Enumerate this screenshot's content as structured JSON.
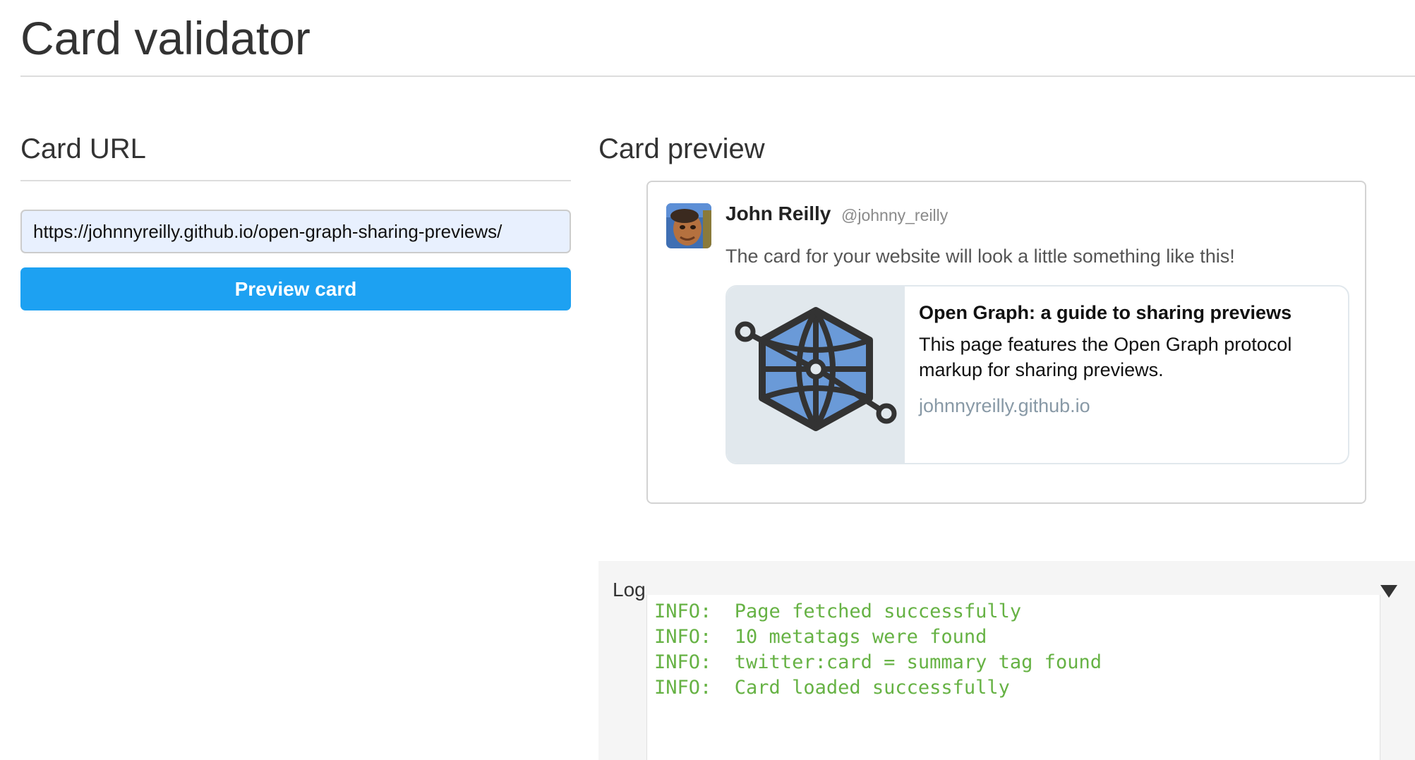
{
  "page": {
    "title": "Card validator"
  },
  "url_section": {
    "heading": "Card URL",
    "input_value": "https://johnnyreilly.github.io/open-graph-sharing-previews/",
    "button_label": "Preview card"
  },
  "preview_section": {
    "heading": "Card preview",
    "tweet": {
      "author_name": "John Reilly",
      "author_handle": "@johnny_reilly",
      "text": "The card for your website will look a little something like this!",
      "avatar_icon": "user-avatar-photo",
      "card": {
        "image_icon": "open-graph-globe-logo",
        "title": "Open Graph: a guide to sharing previews",
        "description": "This page features the Open Graph protocol markup for sharing previews.",
        "domain": "johnnyreilly.github.io"
      }
    }
  },
  "log_section": {
    "label": "Log",
    "toggle_icon": "triangle-down-icon",
    "lines": [
      "INFO:  Page fetched successfully",
      "INFO:  10 metatags were found",
      "INFO:  twitter:card = summary tag found",
      "INFO:  Card loaded successfully"
    ]
  },
  "colors": {
    "button_blue": "#1da1f2",
    "log_green": "#66b244",
    "input_background": "#e8f0fe",
    "card_image_background": "#e1e8ed",
    "og_logo_fill": "#6a9ad8",
    "og_logo_stroke": "#333333"
  }
}
